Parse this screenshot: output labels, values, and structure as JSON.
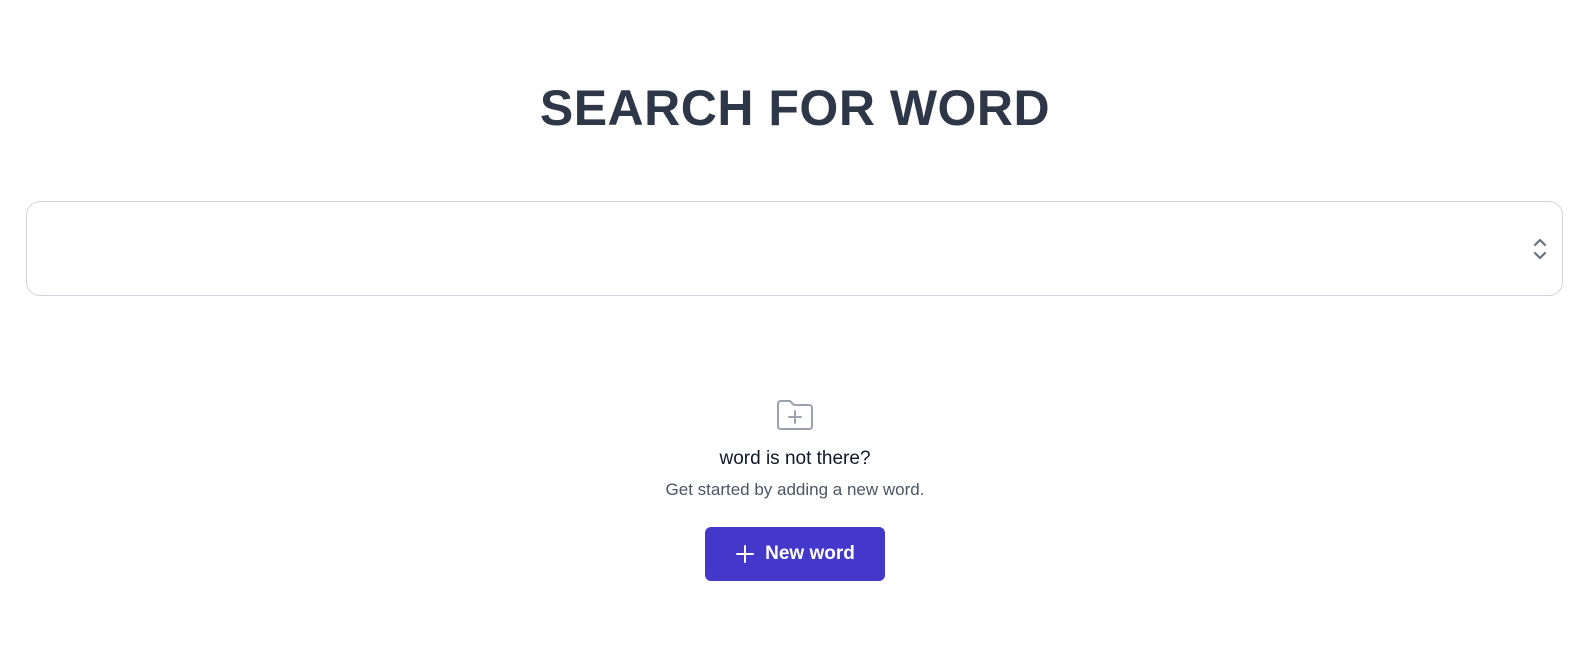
{
  "header": {
    "title": "SEARCH FOR WORD"
  },
  "search": {
    "value": "",
    "placeholder": "",
    "toggle_icon": "chevron-up-down-icon"
  },
  "empty_state": {
    "icon": "folder-plus-icon",
    "title": "word is not there?",
    "subtitle": "Get started by adding a new word.",
    "button_label": "New word",
    "button_icon": "plus-icon"
  },
  "colors": {
    "title": "#2d3748",
    "button_bg": "#4338ca",
    "button_text": "#ffffff",
    "icon": "#9ca3af",
    "border": "#d1d5db"
  }
}
